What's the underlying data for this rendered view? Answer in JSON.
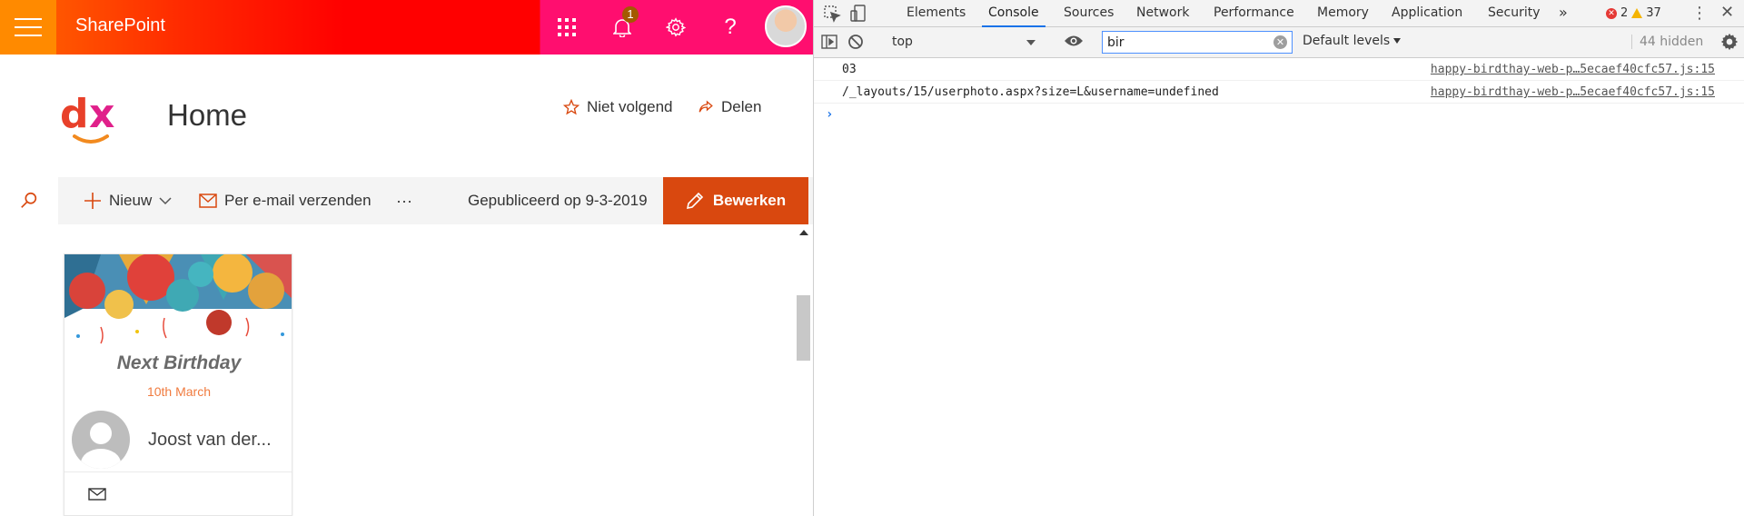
{
  "sharepoint": {
    "brand": "SharePoint",
    "notification_count": "1",
    "site_title": "Home",
    "follow_label": "Niet volgend",
    "share_label": "Delen",
    "command_bar": {
      "new_label": "Nieuw",
      "email_label": "Per e-mail verzenden",
      "more_label": "···",
      "published_label": "Gepubliceerd op 9-3-2019",
      "edit_label": "Bewerken"
    },
    "birthday_card": {
      "title": "Next Birthday",
      "date": "10th March",
      "name": "Joost van der..."
    }
  },
  "devtools": {
    "tabs": [
      "Elements",
      "Console",
      "Sources",
      "Network",
      "Performance",
      "Memory",
      "Application",
      "Security"
    ],
    "active_tab": "Console",
    "overflow_label": "»",
    "error_count": "2",
    "warning_count": "37",
    "toolbar": {
      "context": "top",
      "filter_value": "bir",
      "levels_label": "Default levels",
      "hidden_count": "44 hidden"
    },
    "logs": [
      {
        "message": "03",
        "source": "happy-birdthay-web-p…5ecaef40cfc57.js:15"
      },
      {
        "message": "/_layouts/15/userphoto.aspx?size=L&username=undefined",
        "source": "happy-birdthay-web-p…5ecaef40cfc57.js:15"
      }
    ],
    "prompt_symbol": "›"
  },
  "colors": {
    "accent_orange": "#d9480f",
    "suite_pink": "#ff0e6f",
    "devtools_blue": "#1a73e8"
  }
}
